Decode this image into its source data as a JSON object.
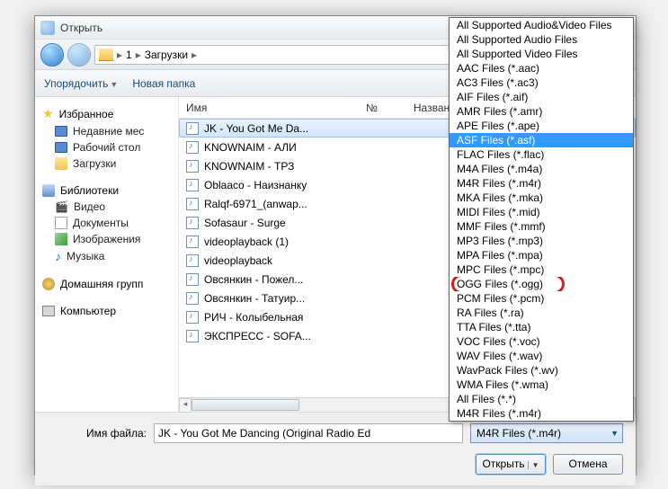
{
  "title": "Открыть",
  "breadcrumb": {
    "p1": "1",
    "p2": "Загрузки"
  },
  "toolbar": {
    "organize": "Упорядочить",
    "newfolder": "Новая папка"
  },
  "sidebar": {
    "fav": "Избранное",
    "recent": "Недавние мес",
    "desktop": "Рабочий стол",
    "downloads": "Загрузки",
    "libs": "Библиотеки",
    "video": "Видео",
    "docs": "Документы",
    "images": "Изображения",
    "music": "Музыка",
    "homegroup": "Домашняя групп",
    "computer": "Компьютер"
  },
  "list": {
    "col_name": "Имя",
    "col_num": "№",
    "col_title": "Название",
    "rows": [
      "JK - You Got Me Da...",
      "KNOWNAIM - АЛИ",
      "KNOWNAIM - ТРЗ",
      "Oblaaco - Наизнанку",
      "Ralqf-6971_(anwap...",
      "Sofasaur - Surge",
      "videoplayback (1)",
      "videoplayback",
      "Овсянкин - Пожел...",
      "Овсянкин - Татуир...",
      "РИЧ - Колыбельная",
      "ЭКСПРЕСС - SOFA..."
    ]
  },
  "footer": {
    "fname_label": "Имя файла:",
    "fname_value": "JK - You Got Me Dancing (Original Radio Ed",
    "type_selected": "M4R Files (*.m4r)",
    "open": "Открыть",
    "cancel": "Отмена"
  },
  "dropdown": [
    "All Supported Audio&Video Files",
    "All Supported Audio Files",
    "All Supported Video Files",
    "AAC Files (*.aac)",
    "AC3 Files (*.ac3)",
    "AIF Files (*.aif)",
    "AMR Files (*.amr)",
    "APE Files (*.ape)",
    "ASF Files (*.asf)",
    "FLAC Files (*.flac)",
    "M4A Files (*.m4a)",
    "M4R Files (*.m4r)",
    "MKA Files (*.mka)",
    "MIDI Files (*.mid)",
    "MMF Files (*.mmf)",
    "MP3 Files (*.mp3)",
    "MPA Files (*.mpa)",
    "MPC Files (*.mpc)",
    "OGG Files (*.ogg)",
    "PCM Files (*.pcm)",
    "RA Files (*.ra)",
    "TTA Files (*.tta)",
    "VOC Files (*.voc)",
    "WAV Files (*.wav)",
    "WavPack Files (*.wv)",
    "WMA Files (*.wma)",
    "All Files (*.*)",
    "M4R Files (*.m4r)"
  ],
  "dropdown_hover_index": 8,
  "dropdown_circled_index": 18
}
